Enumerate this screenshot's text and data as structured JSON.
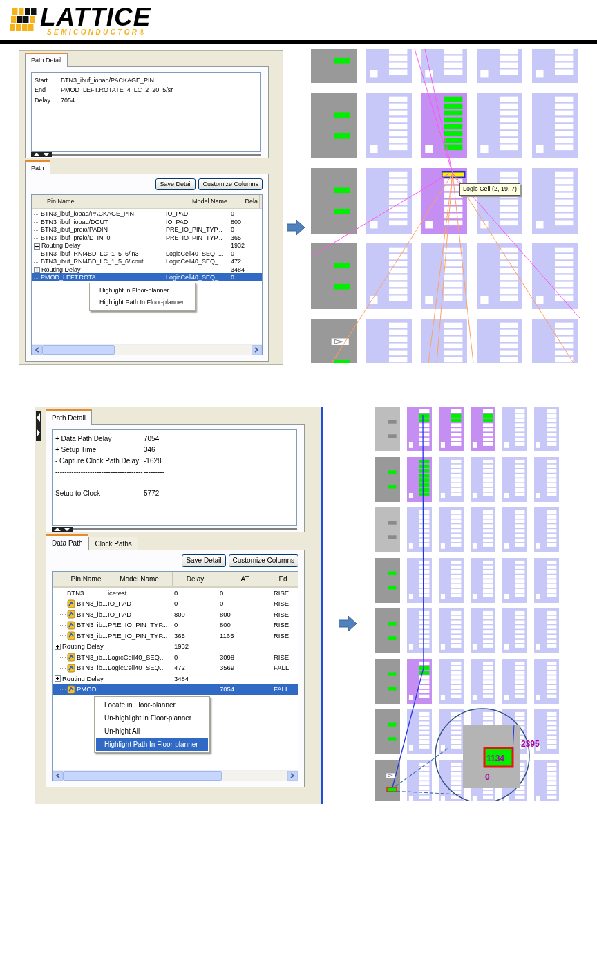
{
  "header": {
    "logo_name": "LATTICE",
    "logo_tagline": "SEMICONDUCTOR®"
  },
  "figures": [
    {
      "panel": {
        "kind": "compact",
        "detail_tabs": [
          {
            "label": "Path Detail",
            "selected": true
          }
        ],
        "summary": [
          {
            "label": "Start",
            "value": "BTN3_ibuf_iopad/PACKAGE_PIN"
          },
          {
            "label": "End",
            "value": "PMOD_LEFT.ROTATE_4_LC_2_20_5/sr"
          },
          {
            "label": "Delay",
            "value": "7054"
          }
        ],
        "tabs": [
          {
            "label": "Path",
            "selected": true
          }
        ],
        "buttons": [
          "Save Detail",
          "Customize Columns"
        ],
        "table": {
          "columns": [
            "Pin Name",
            "Model Name",
            "Dela"
          ],
          "rows": [
            {
              "kind": "leaf",
              "pin": "BTN3_ibuf_iopad/PACKAGE_PIN",
              "model": "IO_PAD",
              "delay": "0",
              "selected": false
            },
            {
              "kind": "leaf",
              "pin": "BTN3_ibuf_iopad/DOUT",
              "model": "IO_PAD",
              "delay": "800",
              "selected": false
            },
            {
              "kind": "leaf",
              "pin": "BTN3_ibuf_preio/PADIN",
              "model": "PRE_IO_PIN_TYP...",
              "delay": "0",
              "selected": false
            },
            {
              "kind": "leaf",
              "pin": "BTN3_ibuf_preio/D_IN_0",
              "model": "PRE_IO_PIN_TYP...",
              "delay": "365",
              "selected": false
            },
            {
              "kind": "group",
              "pin": "Routing Delay",
              "delay": "1932",
              "selected": false
            },
            {
              "kind": "leaf",
              "pin": "BTN3_ibuf_RNI4BD_LC_1_5_6/in3",
              "model": "LogicCell40_SEQ_...",
              "delay": "0",
              "selected": false
            },
            {
              "kind": "leaf",
              "pin": "BTN3_ibuf_RNI4BD_LC_1_5_6/lcout",
              "model": "LogicCell40_SEQ_...",
              "delay": "472",
              "selected": false
            },
            {
              "kind": "group",
              "pin": "Routing Delay",
              "delay": "3484",
              "selected": false
            },
            {
              "kind": "leaf",
              "pin": "PMOD_LEFT.ROTA",
              "model": "LogicCell40_SEQ_...",
              "delay": "0",
              "selected": true
            }
          ]
        },
        "context_menu": [
          {
            "label": "Highlight in Floor-planner",
            "selected": false
          },
          {
            "label": "Highlight Path In Floor-planner",
            "selected": false
          }
        ]
      },
      "floorplan": {
        "kind": "overview",
        "tooltip": "Logic Cell (2, 19, 7)",
        "rows": [
          {
            "tiles": [
              {
                "kind": "io"
              },
              {
                "kind": "logic"
              },
              {
                "kind": "logic"
              },
              {
                "kind": "logic"
              },
              {
                "kind": "logic"
              }
            ]
          },
          {
            "tiles": [
              {
                "kind": "io"
              },
              {
                "kind": "logic"
              },
              {
                "kind": "logic_hl"
              },
              {
                "kind": "logic"
              },
              {
                "kind": "logic"
              }
            ]
          },
          {
            "tiles": [
              {
                "kind": "io"
              },
              {
                "kind": "logic"
              },
              {
                "kind": "logic_sel"
              },
              {
                "kind": "logic"
              },
              {
                "kind": "logic"
              }
            ]
          },
          {
            "tiles": [
              {
                "kind": "io"
              },
              {
                "kind": "logic"
              },
              {
                "kind": "logic"
              },
              {
                "kind": "logic"
              },
              {
                "kind": "logic"
              }
            ]
          },
          {
            "tiles": [
              {
                "kind": "io_buffer"
              },
              {
                "kind": "logic"
              },
              {
                "kind": "logic"
              },
              {
                "kind": "logic"
              },
              {
                "kind": "logic"
              }
            ]
          }
        ]
      }
    },
    {
      "panel": {
        "kind": "full",
        "detail_tabs": [
          {
            "label": "Path Detail",
            "selected": true
          }
        ],
        "summary": [
          {
            "label": "+ Data Path Delay",
            "value": "7054"
          },
          {
            "label": "+ Setup Time",
            "value": "346"
          },
          {
            "label": "- Capture Clock Path Delay",
            "value": "-1628"
          },
          {
            "label": "-----------------------------------------",
            "value": "---------"
          },
          {
            "label": "Setup to Clock",
            "value": "5772"
          }
        ],
        "tabs": [
          {
            "label": "Data Path",
            "selected": true
          },
          {
            "label": "Clock Paths",
            "selected": false
          }
        ],
        "buttons": [
          "Save Detail",
          "Customize Columns"
        ],
        "table": {
          "columns": [
            "Pin Name",
            "Model Name",
            "Delay",
            "AT",
            "Ed"
          ],
          "rows": [
            {
              "kind": "leaf",
              "pin": "BTN3",
              "model": "icetest",
              "delay": "0",
              "at": "0",
              "edge": "RISE",
              "selected": false
            },
            {
              "kind": "pin",
              "pin": "BTN3_ib...",
              "model": "IO_PAD",
              "delay": "0",
              "at": "0",
              "edge": "RISE",
              "selected": false
            },
            {
              "kind": "pin",
              "pin": "BTN3_ib...",
              "model": "IO_PAD",
              "delay": "800",
              "at": "800",
              "edge": "RISE",
              "selected": false
            },
            {
              "kind": "pin",
              "pin": "BTN3_ib...",
              "model": "PRE_IO_PIN_TYP...",
              "delay": "0",
              "at": "800",
              "edge": "RISE",
              "selected": false
            },
            {
              "kind": "pin",
              "pin": "BTN3_ib...",
              "model": "PRE_IO_PIN_TYP...",
              "delay": "365",
              "at": "1165",
              "edge": "RISE",
              "selected": false
            },
            {
              "kind": "group",
              "pin": "Routing Delay",
              "delay": "1932",
              "selected": false
            },
            {
              "kind": "pin",
              "pin": "BTN3_ib...",
              "model": "LogicCell40_SEQ...",
              "delay": "0",
              "at": "3098",
              "edge": "RISE",
              "selected": false
            },
            {
              "kind": "pin",
              "pin": "BTN3_ib...",
              "model": "LogicCell40_SEQ...",
              "delay": "472",
              "at": "3569",
              "edge": "FALL",
              "selected": false
            },
            {
              "kind": "group",
              "pin": "Routing Delay",
              "delay": "3484",
              "selected": false
            },
            {
              "kind": "pin",
              "pin": "PMOD",
              "at": "7054",
              "edge": "FALL",
              "selected": true
            }
          ]
        },
        "context_menu": [
          {
            "label": "Locate in Floor-planner",
            "selected": false
          },
          {
            "label": "Un-highlight in Floor-planner",
            "selected": false
          },
          {
            "label": "Un-hight All",
            "selected": false
          },
          {
            "label": "Highlight Path In Floor-planner",
            "selected": true
          }
        ]
      },
      "floorplan": {
        "kind": "zoomed",
        "magnifier": {
          "upper_label": "2395",
          "cell_label": "1134",
          "lower_label": "0"
        },
        "rows": [
          {
            "tiles": [
              {
                "kind": "io_dim"
              },
              {
                "kind": "logic_part"
              },
              {
                "kind": "logic_part"
              },
              {
                "kind": "logic_part"
              },
              {
                "kind": "logic"
              },
              {
                "kind": "logic"
              }
            ]
          },
          {
            "tiles": [
              {
                "kind": "io"
              },
              {
                "kind": "logic_hl"
              },
              {
                "kind": "logic"
              },
              {
                "kind": "logic"
              },
              {
                "kind": "logic"
              },
              {
                "kind": "logic"
              }
            ]
          },
          {
            "tiles": [
              {
                "kind": "io_dim"
              },
              {
                "kind": "logic"
              },
              {
                "kind": "logic"
              },
              {
                "kind": "logic"
              },
              {
                "kind": "logic"
              },
              {
                "kind": "logic"
              }
            ]
          },
          {
            "tiles": [
              {
                "kind": "io"
              },
              {
                "kind": "logic"
              },
              {
                "kind": "logic"
              },
              {
                "kind": "logic"
              },
              {
                "kind": "logic"
              },
              {
                "kind": "logic"
              }
            ]
          },
          {
            "tiles": [
              {
                "kind": "io"
              },
              {
                "kind": "logic"
              },
              {
                "kind": "logic"
              },
              {
                "kind": "logic"
              },
              {
                "kind": "logic"
              },
              {
                "kind": "logic"
              }
            ]
          },
          {
            "tiles": [
              {
                "kind": "io"
              },
              {
                "kind": "logic_part"
              },
              {
                "kind": "logic"
              },
              {
                "kind": "logic"
              },
              {
                "kind": "logic"
              },
              {
                "kind": "logic"
              }
            ]
          },
          {
            "tiles": [
              {
                "kind": "io"
              },
              {
                "kind": "logic"
              },
              {
                "kind": "logic"
              },
              {
                "kind": "logic"
              },
              {
                "kind": "logic"
              },
              {
                "kind": "logic"
              }
            ]
          },
          {
            "tiles": [
              {
                "kind": "io_buffer"
              },
              {
                "kind": "logic"
              },
              {
                "kind": "logic"
              },
              {
                "kind": "logic"
              },
              {
                "kind": "logic"
              },
              {
                "kind": "logic"
              }
            ]
          }
        ]
      }
    }
  ]
}
